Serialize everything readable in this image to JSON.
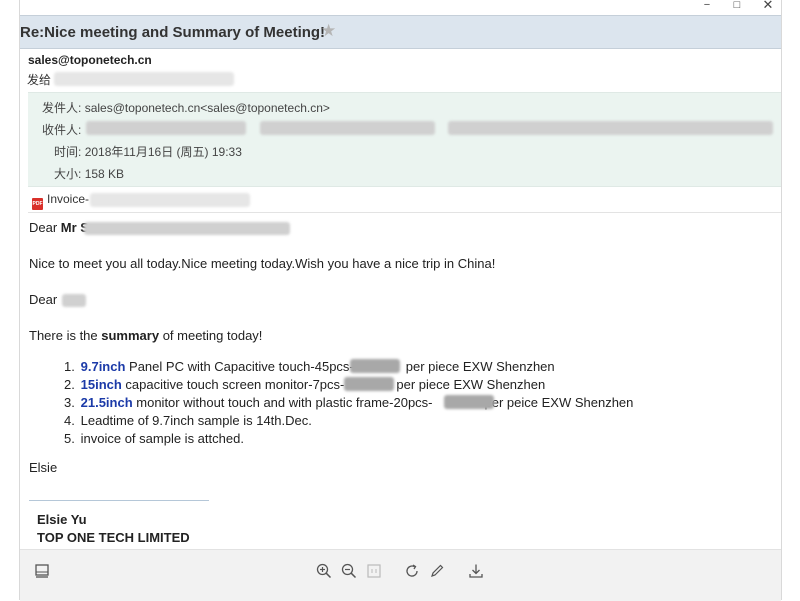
{
  "window": {
    "minimize_glyph": "−",
    "maximize_glyph": "□",
    "close_glyph": "✕"
  },
  "email": {
    "subject": "Re:Nice meeting and Summary of Meeting!",
    "from": "sales@toponetech.cn",
    "to_label": "发给",
    "details": {
      "sender_label": "发件人:",
      "sender_value": "sales@toponetech.cn<sales@toponetech.cn>",
      "recipient_label": "收件人:",
      "time_label": "时间:",
      "time_value": "2018年11月16日 (周五) 19:33",
      "size_label": "大小:",
      "size_value": "158 KB"
    },
    "attachment": {
      "icon_text": "PDF",
      "name": "Invoice-"
    },
    "body": {
      "greeting_prefix": "Dear ",
      "greeting_name": "Mr S",
      "line1": "Nice to meet you all today.Nice meeting today.Wish you have a nice trip in China!",
      "greeting2": "Dear ",
      "line2_a": "There is the ",
      "line2_b": "summary",
      "line2_c": " of meeting today!",
      "items": [
        {
          "num": "1.",
          "highlight": "9.7inch",
          "text": " Panel PC with Capacitive touch-45pcs-",
          "tail": "per piece EXW Shenzhen"
        },
        {
          "num": "2.",
          "highlight": "15inch",
          "text": " capacitive touch screen monitor-7pcs-",
          "tail": "per piece EXW Shenzhen"
        },
        {
          "num": "3.",
          "highlight": "21.5inch",
          "text": " monitor without touch and with plastic frame-20pcs-",
          "tail": "per peice EXW Shenzhen"
        },
        {
          "num": "4.",
          "text": "Leadtime of 9.7inch sample is 14th.Dec."
        },
        {
          "num": "5.",
          "text": "invoice of sample is attched."
        }
      ],
      "signoff": "Elsie",
      "signature_name": "Elsie Yu",
      "signature_company": "TOP ONE TECH LIMITED"
    }
  },
  "toolbar_icons": [
    "tray-icon",
    "zoom-in-icon",
    "zoom-out-icon",
    "fit-page-icon",
    "rotate-icon",
    "edit-icon",
    "download-icon"
  ],
  "colors": {
    "subject_bar": "#dce5ee",
    "detail_bg": "#ebf4f0",
    "highlight_blue": "#1b3aa8",
    "pdf_red": "#d9302a"
  }
}
